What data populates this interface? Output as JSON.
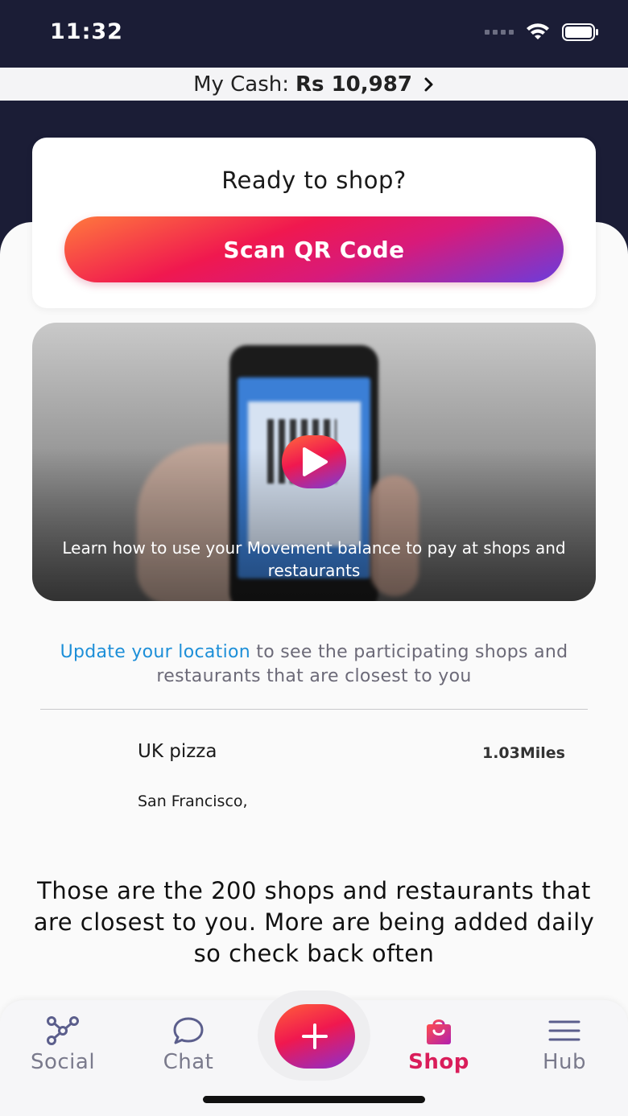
{
  "status_bar": {
    "time": "11:32"
  },
  "cash": {
    "label": "My Cash:",
    "amount": "Rs 10,987"
  },
  "ready_card": {
    "title": "Ready to shop?",
    "button_label": "Scan QR Code"
  },
  "video": {
    "caption": "Learn how to use your Movement balance to pay at shops and restaurants"
  },
  "location": {
    "link_text": "Update your location",
    "rest_text": " to see the participating shops and restaurants that are closest to you"
  },
  "shops": [
    {
      "name": "UK pizza",
      "distance": "1.03Miles",
      "city": "San Francisco,"
    }
  ],
  "footer_note": "Those are the 200 shops and restaurants that are closest to you. More are being added daily so check back often",
  "tabs": {
    "social": "Social",
    "chat": "Chat",
    "shop": "Shop",
    "hub": "Hub",
    "active": "Shop"
  },
  "colors": {
    "accent": "#d91d5a",
    "link": "#1d8fd8",
    "header_bg": "#1b1d36"
  }
}
